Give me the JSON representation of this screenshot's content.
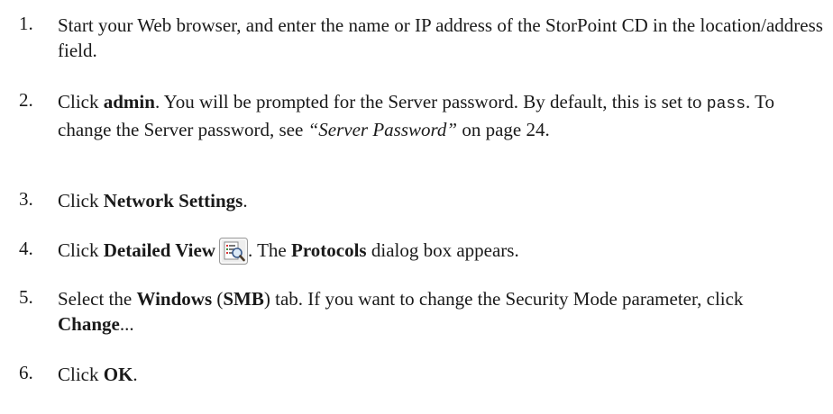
{
  "steps": [
    {
      "num": "1.",
      "text": "Start your Web browser, and enter the name or IP address of the StorPoint CD in the location/address field."
    },
    {
      "num": "2.",
      "t1": "Click ",
      "b1": "admin",
      "t2": ". You will be prompted for the Server password. By default, this is set to ",
      "code": "pass",
      "t3": ". To change the Server password, see ",
      "ref": "“Server Password”",
      "t4": " on page 24."
    },
    {
      "num": "3.",
      "t1": "Click ",
      "b1": "Network Settings",
      "t2": "."
    },
    {
      "num": "4.",
      "t1": "Click ",
      "b1": "Detailed View",
      "icon": "detailed-view-magnifier-icon",
      "t2": ". The ",
      "b2": "Protocols",
      "t3": " dialog box appears."
    },
    {
      "num": "5.",
      "t1": "Select the ",
      "b1": "Windows",
      "t2": " (",
      "b2": "SMB",
      "t3": ") tab. If you want to change the Security Mode parameter, click ",
      "b3": "Change",
      "t4": "..."
    },
    {
      "num": "6.",
      "t1": "Click ",
      "b1": "OK",
      "t2": "."
    }
  ]
}
